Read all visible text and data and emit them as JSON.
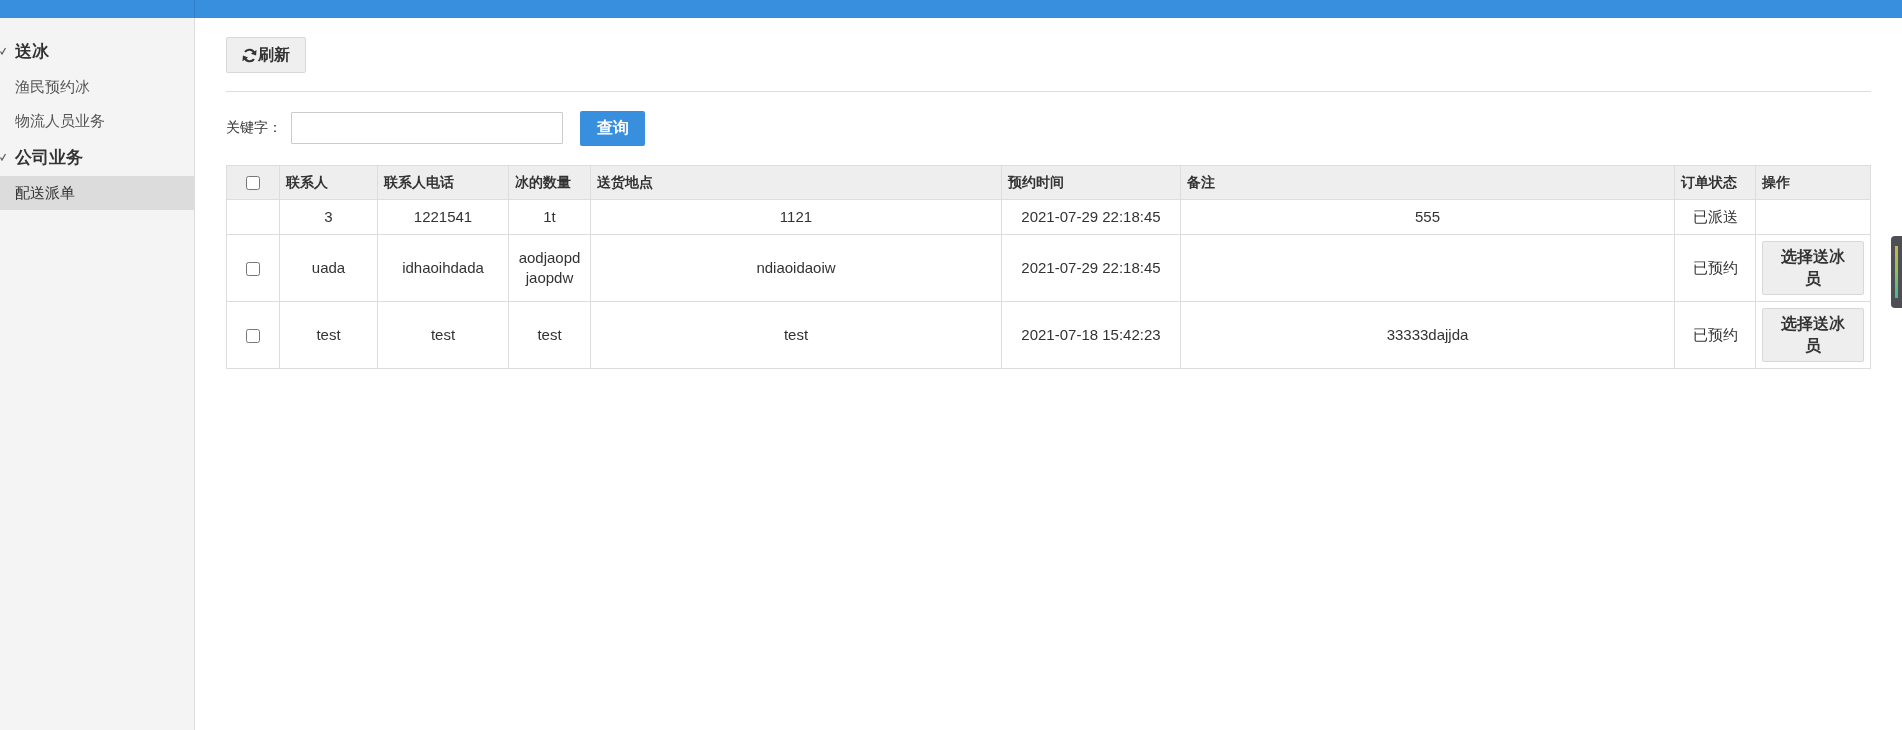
{
  "sidebar": {
    "groups": [
      {
        "title": "送冰",
        "expanded": true,
        "items": [
          {
            "label": "渔民预约冰",
            "selected": false
          },
          {
            "label": "物流人员业务",
            "selected": false
          }
        ]
      },
      {
        "title": "公司业务",
        "expanded": true,
        "items": [
          {
            "label": "配送派单",
            "selected": true
          }
        ]
      }
    ]
  },
  "toolbar": {
    "refresh_button": "刷新"
  },
  "search": {
    "label": "关键字：",
    "button": "查询"
  },
  "table": {
    "select_all": {
      "checked": false
    },
    "columns": [
      "联系人",
      "联系人电话",
      "冰的数量",
      "送货地点",
      "预约时间",
      "备注",
      "订单状态",
      "操作"
    ],
    "rows": [
      {
        "selectable": false,
        "contact": "3",
        "phone": "1221541",
        "quantity": "1t",
        "address": "1121",
        "time": "2021-07-29 22:18:45",
        "remark": "555",
        "status": "已派送"
      },
      {
        "selectable": true,
        "checked": false,
        "contact": "uada",
        "phone": "idhaoihdada",
        "quantity": "aodjaopdjaopdw",
        "address": "ndiaoidaoiw",
        "time": "2021-07-29 22:18:45",
        "status": "已预约",
        "action": "选择送冰员"
      },
      {
        "selectable": true,
        "checked": false,
        "contact": "test",
        "phone": "test",
        "quantity": "test",
        "address": "test",
        "time": "2021-07-18 15:42:23",
        "remark": "33333dajjda",
        "status": "已预约",
        "action": "选择送冰员"
      }
    ]
  }
}
